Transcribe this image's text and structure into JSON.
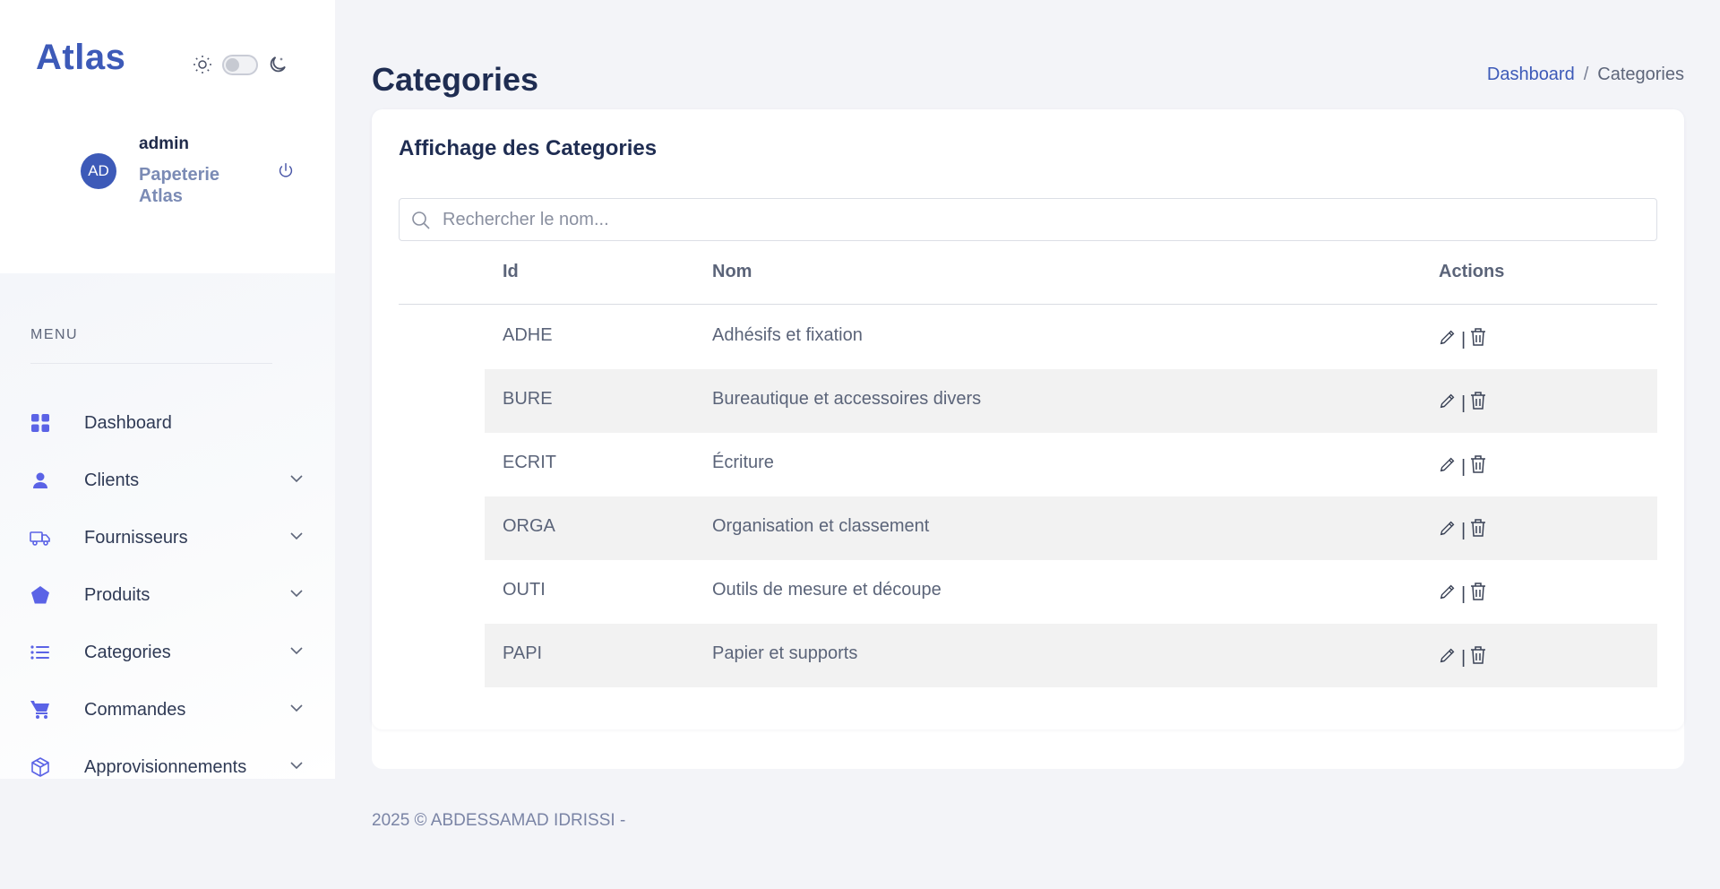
{
  "brand": "Atlas",
  "theme": {
    "light_icon": "sun-icon",
    "dark_icon": "moon-icon",
    "dark_mode": false
  },
  "user": {
    "initials": "AD",
    "name": "admin",
    "org": "Papeterie Atlas"
  },
  "sidebar": {
    "menu_title": "MENU",
    "items": [
      {
        "label": "Dashboard",
        "icon": "grid-icon",
        "has_children": false
      },
      {
        "label": "Clients",
        "icon": "user-icon",
        "has_children": true
      },
      {
        "label": "Fournisseurs",
        "icon": "truck-icon",
        "has_children": true
      },
      {
        "label": "Produits",
        "icon": "pentagon-icon",
        "has_children": true
      },
      {
        "label": "Categories",
        "icon": "list-icon",
        "has_children": true
      },
      {
        "label": "Commandes",
        "icon": "cart-icon",
        "has_children": true
      },
      {
        "label": "Approvisionnements",
        "icon": "box-icon",
        "has_children": true
      }
    ]
  },
  "page": {
    "title": "Categories",
    "breadcrumb": {
      "home": "Dashboard",
      "separator": "/",
      "current": "Categories"
    }
  },
  "card": {
    "title": "Affichage des Categories",
    "search_placeholder": "Rechercher le nom...",
    "columns": {
      "id": "Id",
      "nom": "Nom",
      "actions": "Actions"
    },
    "rows": [
      {
        "id": "ADHE",
        "nom": "Adhésifs et fixation"
      },
      {
        "id": "BURE",
        "nom": "Bureautique et accessoires divers"
      },
      {
        "id": "ECRIT",
        "nom": "Écriture"
      },
      {
        "id": "ORGA",
        "nom": "Organisation et classement"
      },
      {
        "id": "OUTI",
        "nom": "Outils de mesure et découpe"
      },
      {
        "id": "PAPI",
        "nom": "Papier et supports"
      }
    ],
    "action_separator": "|"
  },
  "footer": "2025 © ABDESSAMAD IDRISSI -",
  "colors": {
    "accent": "#3d5ab8",
    "icon_accent": "#5b63e6",
    "row_alt": "#f2f2f2"
  }
}
